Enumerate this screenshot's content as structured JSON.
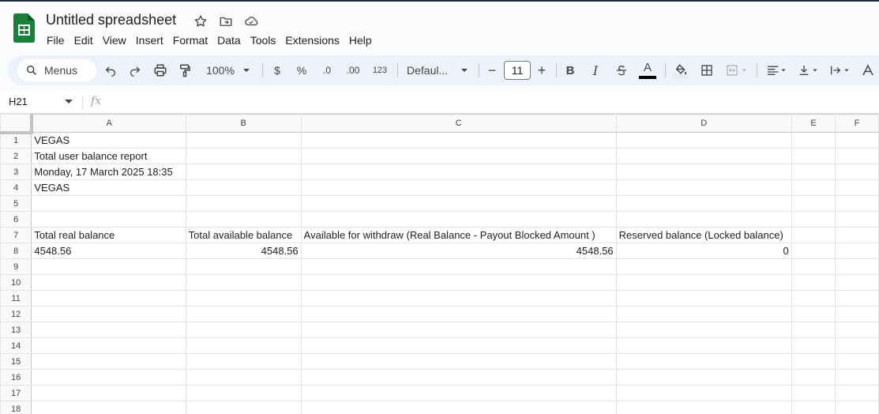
{
  "app": {
    "title": "Untitled spreadsheet",
    "menu": [
      "File",
      "Edit",
      "View",
      "Insert",
      "Format",
      "Data",
      "Tools",
      "Extensions",
      "Help"
    ]
  },
  "toolbar": {
    "search_label": "Menus",
    "zoom": "100%",
    "currency": "$",
    "percent": "%",
    "decrease_decimal": ".0",
    "increase_decimal": ".00",
    "more_formats": "123",
    "font_name": "Defaul...",
    "font_size": "11",
    "minus": "−",
    "plus": "+",
    "bold": "B",
    "italic": "I",
    "text_color_letter": "A",
    "accent_color": "#188038"
  },
  "formula_bar": {
    "name_box": "H21",
    "fx": "fx",
    "value": ""
  },
  "sheet": {
    "columns": [
      "A",
      "B",
      "C",
      "D",
      "E",
      "F"
    ],
    "rows": [
      "1",
      "2",
      "3",
      "4",
      "5",
      "6",
      "7",
      "8",
      "9",
      "10",
      "11",
      "12",
      "13",
      "14",
      "15",
      "16",
      "17",
      "18"
    ],
    "cells": [
      [
        "VEGAS",
        "",
        "",
        "",
        "",
        ""
      ],
      [
        "Total user balance report",
        "",
        "",
        "",
        "",
        ""
      ],
      [
        "Monday, 17 March 2025 18:35",
        "",
        "",
        "",
        "",
        ""
      ],
      [
        "VEGAS",
        "",
        "",
        "",
        "",
        ""
      ],
      [
        "",
        "",
        "",
        "",
        "",
        ""
      ],
      [
        "",
        "",
        "",
        "",
        "",
        ""
      ],
      [
        "Total real balance",
        "Total available balance",
        "Available for withdraw (Real Balance - Payout Blocked Amount )",
        "Reserved balance (Locked balance)",
        "",
        ""
      ],
      [
        "4548.56",
        "4548.56",
        "4548.56",
        "0",
        "",
        ""
      ],
      [
        "",
        "",
        "",
        "",
        "",
        ""
      ],
      [
        "",
        "",
        "",
        "",
        "",
        ""
      ],
      [
        "",
        "",
        "",
        "",
        "",
        ""
      ],
      [
        "",
        "",
        "",
        "",
        "",
        ""
      ],
      [
        "",
        "",
        "",
        "",
        "",
        ""
      ],
      [
        "",
        "",
        "",
        "",
        "",
        ""
      ],
      [
        "",
        "",
        "",
        "",
        "",
        ""
      ],
      [
        "",
        "",
        "",
        "",
        "",
        ""
      ],
      [
        "",
        "",
        "",
        "",
        "",
        ""
      ],
      [
        "",
        "",
        "",
        "",
        "",
        ""
      ]
    ],
    "numeric_right_aligned": [
      [
        7,
        1
      ],
      [
        7,
        2
      ],
      [
        7,
        3
      ]
    ]
  }
}
